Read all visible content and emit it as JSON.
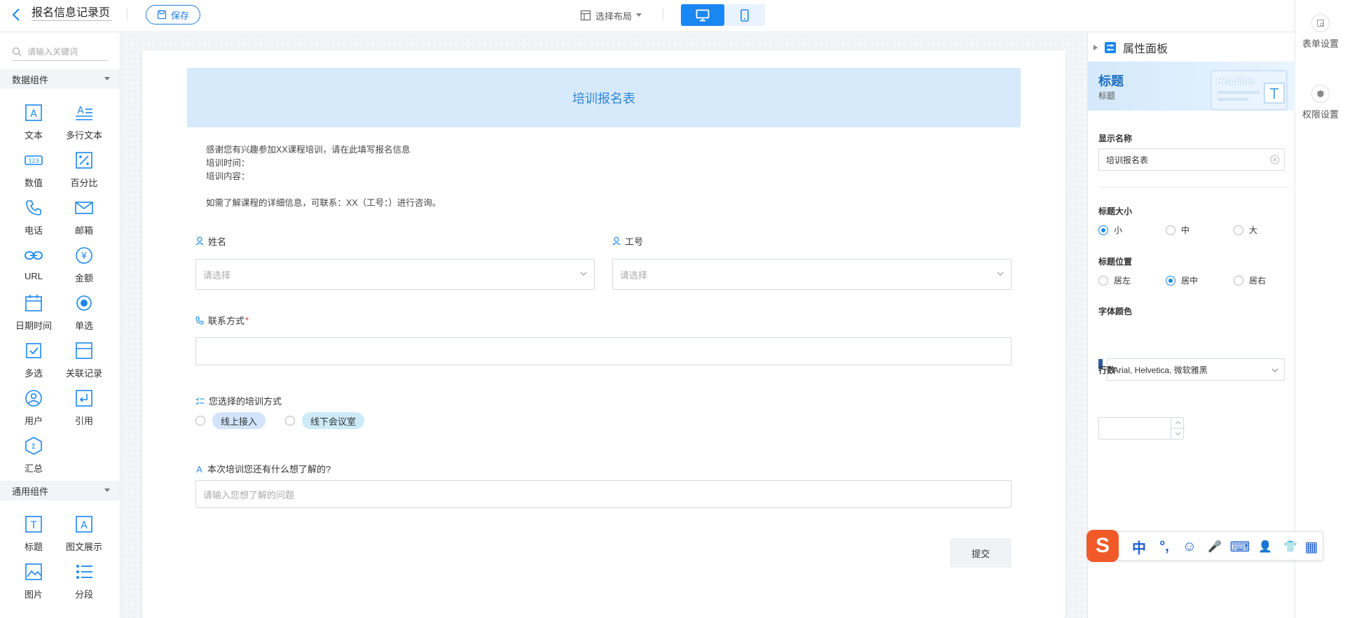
{
  "topbar": {
    "page_name": "报名信息记录页",
    "save_label": "保存",
    "layout_label": "选择布局"
  },
  "rail": {
    "form_settings": "表单设置",
    "permission_settings": "权限设置"
  },
  "palette": {
    "search_placeholder": "请输入关键词",
    "data_group": "数据组件",
    "data_items": [
      "文本",
      "多行文本",
      "数值",
      "百分比",
      "电话",
      "邮箱",
      "URL",
      "金额",
      "日期时间",
      "单选",
      "多选",
      "关联记录",
      "用户",
      "引用",
      "汇总"
    ],
    "general_group": "通用组件",
    "general_items": [
      "标题",
      "图文展示",
      "图片",
      "分段"
    ]
  },
  "form": {
    "title": "培训报名表",
    "intro": [
      "感谢您有兴趣参加XX课程培训，请在此填写报名信息",
      "培训时间：",
      "培训内容：",
      "",
      "如需了解课程的详细信息，可联系：XX（工号：）进行咨询。"
    ],
    "name_label": "姓名",
    "name_placeholder": "请选择",
    "id_label": "工号",
    "id_placeholder": "请选择",
    "contact_label": "联系方式",
    "contact_required": "*",
    "training_label": "您选择的培训方式",
    "training_options": [
      "线上接入",
      "线下会议室"
    ],
    "question_label": "本次培训您还有什么想了解的?",
    "question_placeholder": "请输入您想了解的问题",
    "submit_label": "提交"
  },
  "props": {
    "header": "属性面板",
    "component_title": "标题",
    "component_sub": "标题",
    "art_text": "Headline",
    "display_name_label": "显示名称",
    "display_name_value": "培训报名表",
    "size_label": "标题大小",
    "size_options": [
      "小",
      "中",
      "大"
    ],
    "size_selected": "小",
    "position_label": "标题位置",
    "position_options": [
      "居左",
      "居中",
      "居右"
    ],
    "position_selected": "居中",
    "font_color_label": "字体颜色",
    "font_value": "Arial, Helvetica, 微软雅黑",
    "rows_label": "行数"
  },
  "ime": {
    "logo": "S",
    "items": [
      "中",
      "°,",
      "☺",
      "🎤",
      "⌨",
      "👤",
      "👕",
      "▦"
    ]
  },
  "colors": {
    "accent": "#1a87f0",
    "title_band": "#d7eafc",
    "title_text": "#2e86d8"
  }
}
